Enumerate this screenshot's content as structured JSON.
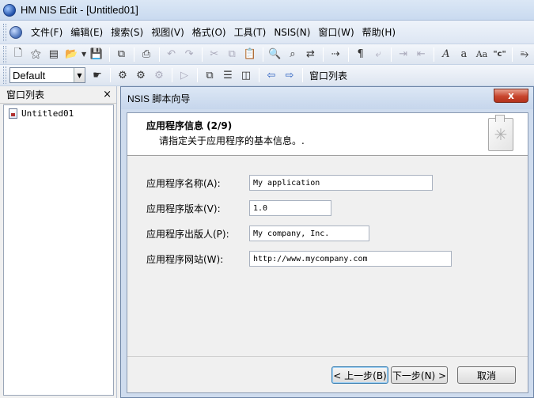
{
  "window": {
    "title": "HM NIS Edit - [Untitled01]"
  },
  "menu": [
    "文件(F)",
    "编辑(E)",
    "搜索(S)",
    "视图(V)",
    "格式(O)",
    "工具(T)",
    "NSIS(N)",
    "窗口(W)",
    "帮助(H)"
  ],
  "toolbar": {
    "style_combo": "Default",
    "window_list_label": "窗口列表"
  },
  "left_panel": {
    "title": "窗口列表",
    "close": "×",
    "items": [
      "Untitled01"
    ]
  },
  "dialog": {
    "title": "NSIS 脚本向导",
    "close": "x",
    "header_title": "应用程序信息 (2/9)",
    "header_subtitle": "请指定关于应用程序的基本信息。.",
    "fields": [
      {
        "label": "应用程序名称(A):",
        "value": "My application"
      },
      {
        "label": "应用程序版本(V):",
        "value": "1.0"
      },
      {
        "label": "应用程序出版人(P):",
        "value": "My company, Inc."
      },
      {
        "label": "应用程序网站(W):",
        "value": "http://www.mycompany.com"
      }
    ],
    "buttons": {
      "back": "< 上一步(B)",
      "next": "下一步(N) >",
      "cancel": "取消"
    }
  }
}
